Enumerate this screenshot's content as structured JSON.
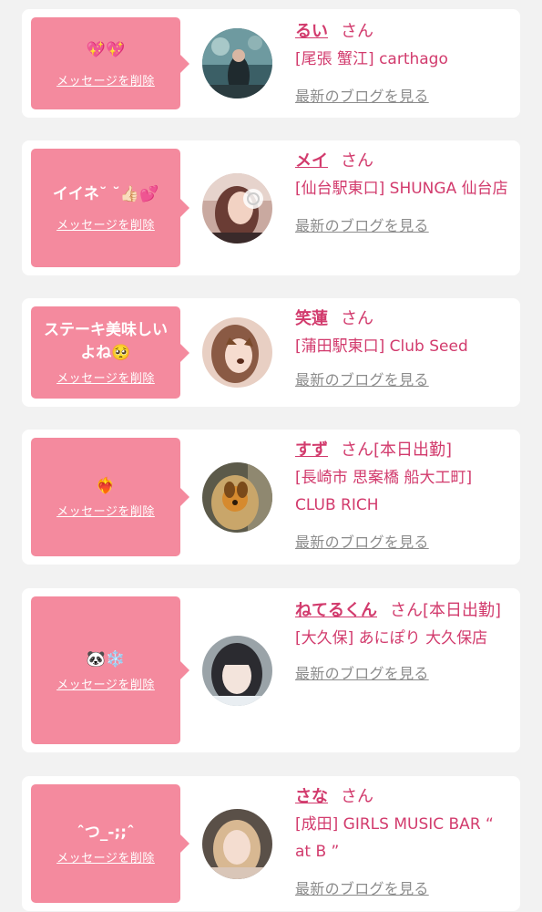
{
  "common": {
    "delete_label": "メッセージを削除",
    "san_label": "さん",
    "blog_label": "最新のブログを見る"
  },
  "colors": {
    "page_bg": "#f2f2f2",
    "bubble_bg": "#f48a9e",
    "accent": "#d23b6d",
    "muted_link": "#8c8c8c"
  },
  "messages": [
    {
      "message": "💖💖",
      "name": "るい",
      "status": "",
      "shop": "[尾張 蟹江] carthago"
    },
    {
      "message": "イイネ˘ ˘👍🏻💕",
      "name": "メイ",
      "status": "",
      "shop": "[仙台駅東口] SHUNGA 仙台店"
    },
    {
      "message": "ステーキ美味しいよね🥺",
      "name": "笑蓮",
      "status": "",
      "shop": "[蒲田駅東口] Club Seed"
    },
    {
      "message": "❤️‍🔥",
      "name": "すず",
      "status": "[本日出勤]",
      "shop": "[長崎市 思案橋 船大工町] CLUB RICH"
    },
    {
      "message": "🐼❄️",
      "name": "ねてるくん",
      "status": "[本日出勤]",
      "shop": "[大久保] あにぽり 大久保店"
    },
    {
      "message": "ˆつ_-;;ˆ",
      "name": "さな",
      "status": "",
      "shop": "[成田] GIRLS MUSIC BAR “ at B ”"
    }
  ]
}
